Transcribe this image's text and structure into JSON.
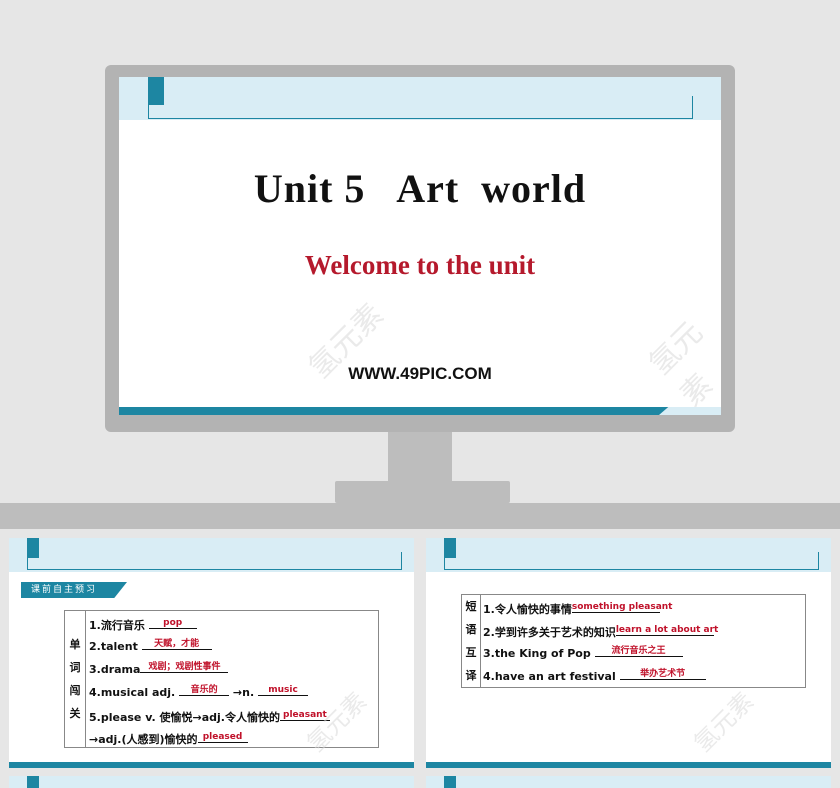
{
  "main_slide": {
    "title": "Unit 5   Art  world",
    "subtitle": "Welcome to the unit",
    "website": "WWW.49PIC.COM",
    "watermark": "氢元素"
  },
  "slide_left": {
    "section_tag": "课前自主预习",
    "side_label": [
      "单",
      "词",
      "闯",
      "关"
    ],
    "rows": [
      {
        "prefix": "1.流行音乐",
        "answer": "pop"
      },
      {
        "prefix": "2.talent",
        "answer": "天赋，才能"
      },
      {
        "prefix": "3.drama",
        "answer": "戏剧；戏剧性事件"
      },
      {
        "prefix": "4.musical adj.",
        "answer": "音乐的",
        "mid": "→n.",
        "answer2": "music"
      },
      {
        "prefix": "5.please v.  使愉悦→adj.令人愉快的",
        "answer": "pleasant"
      },
      {
        "prefix": "→adj.(人感到)愉快的",
        "answer": "pleased"
      }
    ]
  },
  "slide_right": {
    "side_label": [
      "短",
      "语",
      "互",
      "译"
    ],
    "rows": [
      {
        "prefix": "1.令人愉快的事情",
        "answer": "something pleasant"
      },
      {
        "prefix": "2.学到许多关于艺术的知识",
        "answer": "learn a lot about art"
      },
      {
        "prefix": "3.the King of Pop",
        "answer": "流行音乐之王"
      },
      {
        "prefix": "4.have an art festival",
        "answer": "举办艺术节"
      }
    ]
  }
}
